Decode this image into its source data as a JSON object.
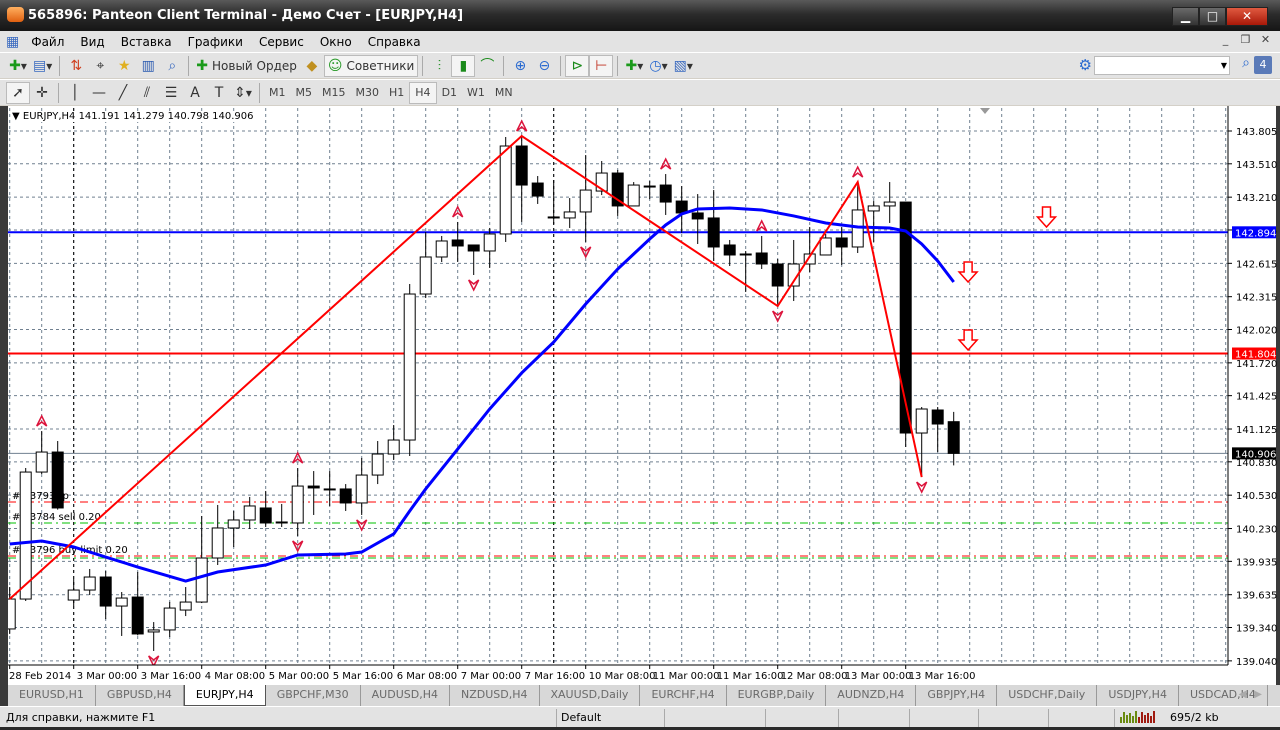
{
  "window": {
    "title": "565896: Panteon Client Terminal - Демо Счет - [EURJPY,H4]",
    "min": "▁",
    "max": "□",
    "close": "✕"
  },
  "menu": [
    "Файл",
    "Вид",
    "Вставка",
    "Графики",
    "Сервис",
    "Окно",
    "Справка"
  ],
  "mdi": {
    "min": "_",
    "restore": "❐",
    "close": "✕"
  },
  "toolbar": {
    "new_order": "Новый Ордер",
    "experts": "Советники",
    "notif_count": "4"
  },
  "timeframes": [
    "M1",
    "M5",
    "M15",
    "M30",
    "H1",
    "H4",
    "D1",
    "W1",
    "MN"
  ],
  "active_timeframe": "H4",
  "chart": {
    "header": "EURJPY,H4  141.191 141.279 140.798 140.906",
    "colors": {
      "bull": "#ffffff",
      "bear": "#000000",
      "ma": "#0000ff",
      "zigzag": "#ff0000",
      "fractal": "#dc143c",
      "grid": "#708090"
    },
    "price_ticks": [
      "143.805",
      "143.510",
      "143.210",
      "142.915",
      "142.615",
      "142.315",
      "142.020",
      "141.720",
      "141.425",
      "141.125",
      "140.830",
      "140.530",
      "140.230",
      "139.935",
      "139.635",
      "139.340",
      "139.040"
    ],
    "time_labels": [
      "28 Feb 2014",
      "3 Mar 00:00",
      "3 Mar 16:00",
      "4 Mar 08:00",
      "5 Mar 00:00",
      "5 Mar 16:00",
      "6 Mar 08:00",
      "7 Mar 00:00",
      "7 Mar 16:00",
      "10 Mar 08:00",
      "11 Mar 00:00",
      "11 Mar 16:00",
      "12 Mar 08:00",
      "13 Mar 00:00",
      "13 Mar 16:00"
    ],
    "week_separators": [
      4,
      34
    ],
    "candles": [
      [
        139.327,
        139.704,
        139.282,
        139.596
      ],
      [
        139.596,
        140.774,
        139.578,
        140.738
      ],
      [
        140.738,
        141.107,
        140.72,
        140.918
      ],
      [
        140.918,
        141.017,
        140.4,
        140.415
      ],
      [
        139.587,
        139.776,
        139.533,
        139.677
      ],
      [
        139.677,
        139.866,
        139.632,
        139.794
      ],
      [
        139.794,
        139.848,
        139.416,
        139.533
      ],
      [
        139.533,
        139.659,
        139.264,
        139.605
      ],
      [
        139.614,
        139.839,
        139.27,
        139.282
      ],
      [
        139.3,
        139.389,
        139.129,
        139.318
      ],
      [
        139.318,
        139.569,
        139.255,
        139.515
      ],
      [
        139.497,
        139.704,
        139.443,
        139.569
      ],
      [
        139.569,
        140.343,
        139.56,
        139.965
      ],
      [
        139.965,
        140.442,
        139.902,
        140.235
      ],
      [
        140.235,
        140.388,
        140.064,
        140.307
      ],
      [
        140.307,
        140.514,
        140.226,
        140.433
      ],
      [
        140.415,
        140.568,
        140.244,
        140.28
      ],
      [
        140.289,
        140.451,
        140.244,
        140.28
      ],
      [
        140.28,
        140.774,
        140.163,
        140.612
      ],
      [
        140.612,
        140.747,
        140.352,
        140.595
      ],
      [
        140.586,
        140.747,
        140.433,
        140.586
      ],
      [
        140.586,
        140.63,
        140.388,
        140.46
      ],
      [
        140.46,
        140.864,
        140.352,
        140.711
      ],
      [
        140.711,
        141.017,
        140.63,
        140.9
      ],
      [
        140.9,
        141.161,
        140.846,
        141.026
      ],
      [
        141.026,
        142.429,
        140.882,
        142.339
      ],
      [
        142.339,
        142.897,
        142.303,
        142.672
      ],
      [
        142.672,
        142.861,
        142.627,
        142.816
      ],
      [
        142.825,
        142.987,
        142.627,
        142.771
      ],
      [
        142.78,
        142.78,
        142.51,
        142.726
      ],
      [
        142.726,
        142.933,
        142.573,
        142.879
      ],
      [
        142.879,
        143.751,
        142.807,
        143.67
      ],
      [
        143.67,
        143.76,
        142.987,
        143.319
      ],
      [
        143.337,
        143.4,
        143.149,
        143.22
      ],
      [
        143.032,
        143.364,
        142.969,
        143.032
      ],
      [
        143.023,
        143.202,
        142.933,
        143.077
      ],
      [
        143.077,
        143.589,
        142.807,
        143.274
      ],
      [
        143.265,
        143.535,
        143.229,
        143.427
      ],
      [
        143.427,
        143.454,
        143.041,
        143.131
      ],
      [
        143.131,
        143.346,
        143.131,
        143.319
      ],
      [
        143.31,
        143.355,
        143.193,
        143.31
      ],
      [
        143.319,
        143.418,
        143.05,
        143.166
      ],
      [
        143.175,
        143.31,
        142.888,
        143.068
      ],
      [
        143.068,
        143.238,
        142.789,
        143.014
      ],
      [
        143.023,
        143.274,
        142.636,
        142.762
      ],
      [
        142.78,
        142.825,
        142.591,
        142.69
      ],
      [
        142.699,
        142.726,
        142.357,
        142.699
      ],
      [
        142.708,
        142.861,
        142.564,
        142.609
      ],
      [
        142.609,
        142.654,
        142.231,
        142.411
      ],
      [
        142.411,
        142.825,
        142.276,
        142.609
      ],
      [
        142.609,
        142.942,
        142.537,
        142.699
      ],
      [
        142.69,
        142.879,
        142.69,
        142.843
      ],
      [
        142.843,
        142.942,
        142.6,
        142.762
      ],
      [
        142.762,
        143.346,
        142.708,
        143.095
      ],
      [
        143.086,
        143.175,
        142.807,
        143.131
      ],
      [
        143.131,
        143.346,
        142.978,
        143.166
      ],
      [
        143.166,
        143.17,
        140.963,
        141.089
      ],
      [
        141.089,
        141.323,
        140.693,
        141.305
      ],
      [
        141.296,
        141.323,
        140.918,
        141.17
      ],
      [
        141.191,
        141.279,
        140.798,
        140.906
      ]
    ],
    "ma": [
      [
        0,
        140.091
      ],
      [
        2,
        140.118
      ],
      [
        4,
        140.064
      ],
      [
        6,
        139.974
      ],
      [
        8,
        139.884
      ],
      [
        11,
        139.758
      ],
      [
        13,
        139.839
      ],
      [
        16,
        139.902
      ],
      [
        18,
        139.992
      ],
      [
        21,
        140.001
      ],
      [
        22,
        140.019
      ],
      [
        24,
        140.181
      ],
      [
        25,
        140.388
      ],
      [
        26,
        140.586
      ],
      [
        28,
        140.945
      ],
      [
        30,
        141.305
      ],
      [
        32,
        141.629
      ],
      [
        34,
        141.907
      ],
      [
        36,
        142.249
      ],
      [
        38,
        142.564
      ],
      [
        39,
        142.699
      ],
      [
        40,
        142.834
      ],
      [
        41,
        142.96
      ],
      [
        42,
        143.059
      ],
      [
        43,
        143.104
      ],
      [
        45,
        143.113
      ],
      [
        47,
        143.095
      ],
      [
        49,
        143.041
      ],
      [
        51,
        142.978
      ],
      [
        53,
        142.942
      ],
      [
        55,
        142.933
      ],
      [
        56,
        142.906
      ],
      [
        57,
        142.789
      ],
      [
        58,
        142.636
      ],
      [
        59,
        142.447
      ]
    ],
    "zigzag": [
      [
        0,
        139.596
      ],
      [
        32,
        143.76
      ],
      [
        48,
        142.231
      ],
      [
        53,
        143.346
      ],
      [
        57,
        140.693
      ]
    ],
    "fractals_up": [
      2,
      18,
      28,
      32,
      41,
      47,
      53
    ],
    "fractals_down": [
      9,
      18,
      22,
      29,
      36,
      48,
      57
    ],
    "signal_arrows": [
      [
        59.9,
        142.519
      ],
      [
        59.9,
        141.907
      ],
      [
        64.8,
        143.014
      ]
    ],
    "hlines": [
      {
        "price": 142.894,
        "label": "142.894",
        "color": "#0000ff"
      },
      {
        "price": 141.804,
        "label": "141.804",
        "color": "#ff0000"
      },
      {
        "price": 140.906,
        "label": "140.906",
        "color": "#000000"
      }
    ],
    "orders": [
      {
        "price": 140.469,
        "label": "#  33793 tp",
        "color": "#ff0000"
      },
      {
        "price": 140.28,
        "label": "#  33784 sell 0.20",
        "color": "#00c000"
      },
      {
        "price": 139.983,
        "label": "#  33796 buy limit 0.20",
        "color": "#ff0000"
      },
      {
        "price": 139.965,
        "label": "",
        "color": "#00c000"
      }
    ]
  },
  "tabs": [
    "EURUSD,H1",
    "GBPUSD,H4",
    "EURJPY,H4",
    "GBPCHF,M30",
    "AUDUSD,H4",
    "NZDUSD,H4",
    "XAUUSD,Daily",
    "EURCHF,H4",
    "EURGBP,Daily",
    "AUDNZD,H4",
    "GBPJPY,H4",
    "USDCHF,Daily",
    "USDJPY,H4",
    "USDCAD,H4"
  ],
  "active_tab": "EURJPY,H4",
  "status": {
    "help": "Для справки, нажмите F1",
    "profile": "Default",
    "traffic": "695/2 kb"
  }
}
